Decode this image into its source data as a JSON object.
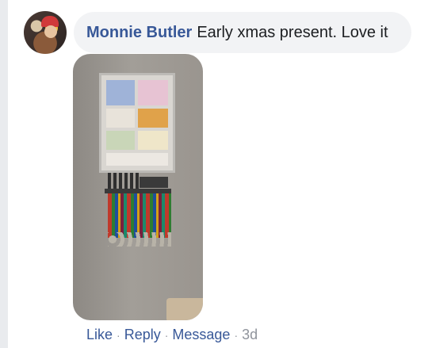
{
  "comment": {
    "author": "Monnie Butler",
    "text": "Early xmas present. Love it"
  },
  "actions": {
    "like": "Like",
    "reply": "Reply",
    "message": "Message",
    "separator": "·",
    "timestamp": "3d"
  },
  "colors": {
    "link": "#385898",
    "bubble": "#f2f3f5",
    "meta": "#90949c",
    "rail": "#e9ebee"
  }
}
